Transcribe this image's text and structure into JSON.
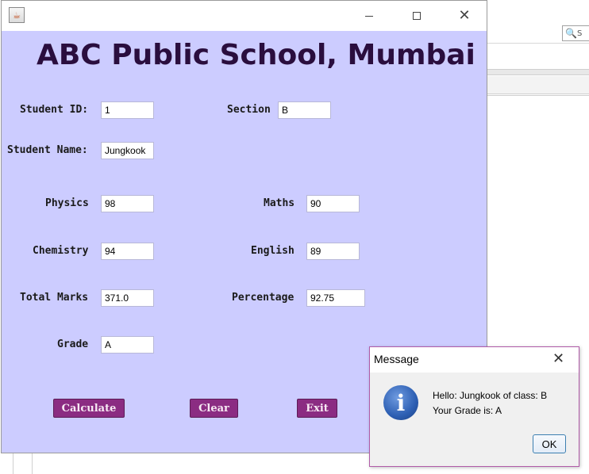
{
  "window": {
    "icon": "java-icon",
    "minimize_icon": "minimize-icon",
    "maximize_icon": "maximize-icon",
    "close_glyph": "✕"
  },
  "background": {
    "search_glyph": "🔍",
    "search_hint": "S"
  },
  "school_title": "ABC Public School, Mumbai",
  "form": {
    "student_id": {
      "label": "Student ID:",
      "value": "1"
    },
    "section": {
      "label": "Section",
      "value": "B"
    },
    "student_name": {
      "label": "Student Name:",
      "value": "Jungkook"
    },
    "physics": {
      "label": "Physics",
      "value": "98"
    },
    "maths": {
      "label": "Maths",
      "value": "90"
    },
    "chemistry": {
      "label": "Chemistry",
      "value": "94"
    },
    "english": {
      "label": "English",
      "value": "89"
    },
    "total_marks": {
      "label": "Total Marks",
      "value": "371.0"
    },
    "percentage": {
      "label": "Percentage",
      "value": "92.75"
    },
    "grade": {
      "label": "Grade",
      "value": "A"
    }
  },
  "buttons": {
    "calculate": "Calculate",
    "clear": "Clear",
    "exit": "Exit"
  },
  "dialog": {
    "title": "Message",
    "close_glyph": "✕",
    "icon_glyph": "i",
    "line1": "Hello: Jungkook of class: B",
    "line2": "Your Grade is: A",
    "ok_label": "OK"
  },
  "colors": {
    "form_background": "#ccccff",
    "title_text": "#2a0e3e",
    "button_background": "#8b2c82",
    "dialog_border": "#b05ba8"
  }
}
